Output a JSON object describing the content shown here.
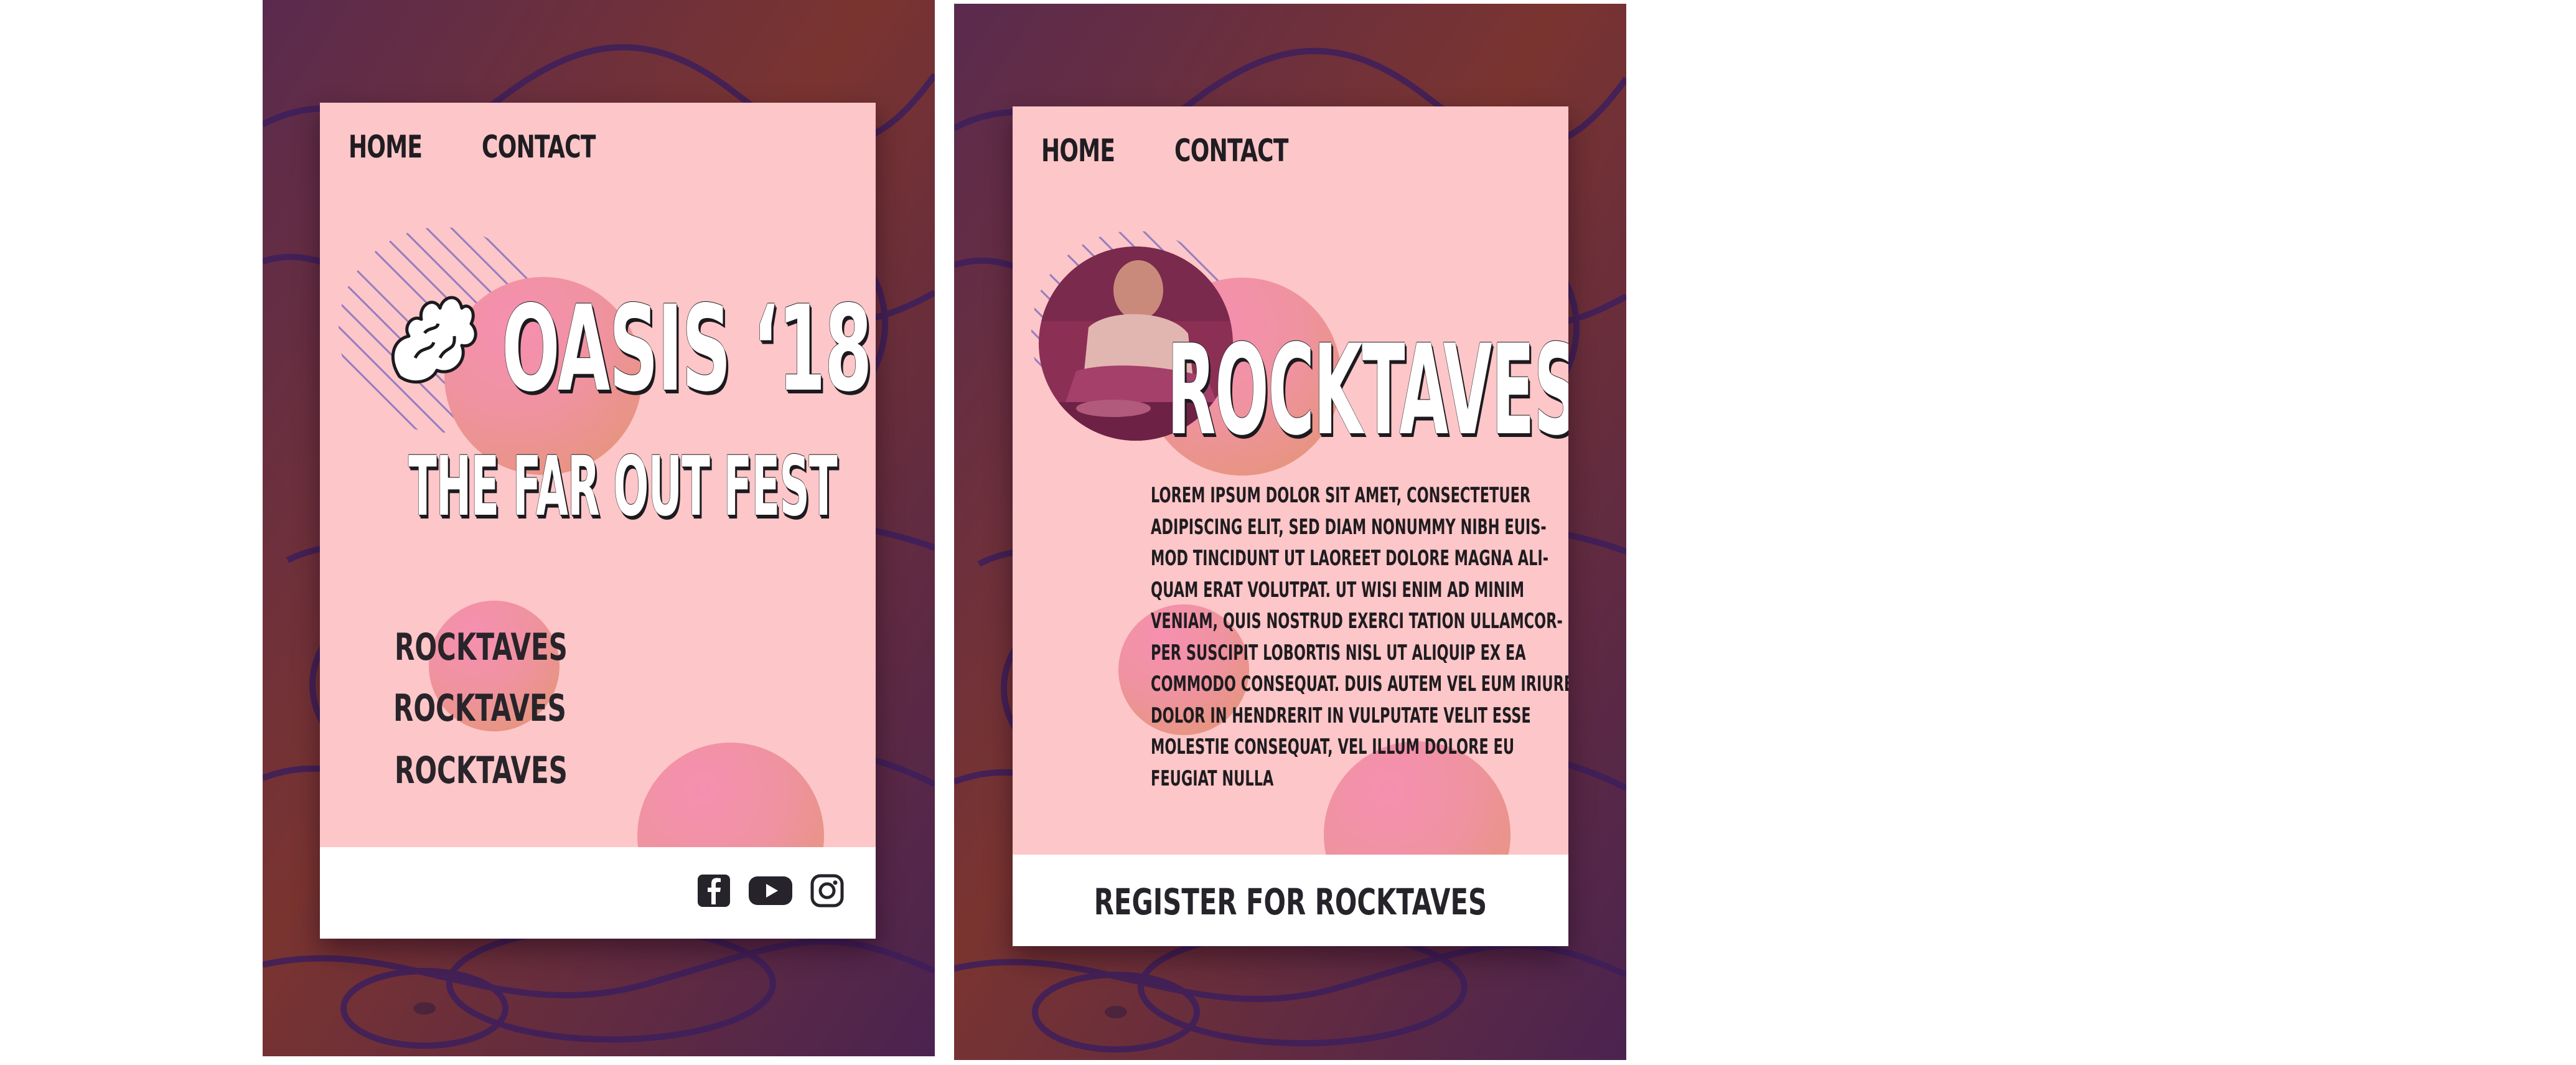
{
  "colors": {
    "card_bg": "#fdc6c8",
    "bg_dark": "#4a2355",
    "bg_orange": "#8a3a28",
    "text_dark": "#1f1d22",
    "circle_pink": "#f68fb0",
    "circle_orange": "#e39470"
  },
  "screen1": {
    "nav": {
      "home": "HOME",
      "contact": "CONTACT"
    },
    "logo_icon": "flame-hand-icon",
    "title": "OASIS ‘18",
    "subtitle": "THE FAR OUT FEST",
    "menu": [
      "ROCKTAVES",
      "ROCKTAVES",
      "ROCKTAVES"
    ],
    "social": [
      "facebook-icon",
      "youtube-icon",
      "instagram-icon"
    ]
  },
  "screen2": {
    "nav": {
      "home": "HOME",
      "contact": "CONTACT"
    },
    "title": "ROCKTAVES",
    "body": "LOREM IPSUM DOLOR SIT AMET, CONSECTETUER ADIPISCING ELIT, SED DIAM NONUMMY NIBH EUIS-MOD TINCIDUNT UT LAOREET DOLORE MAGNA ALI-QUAM ERAT VOLUTPAT. UT WISI ENIM AD MINIM VENIAM, QUIS NOSTRUD EXERCI TATION ULLAMCOR-PER SUSCIPIT LOBORTIS NISL UT ALIQUIP EX EA COMMODO CONSEQUAT. DUIS AUTEM VEL EUM IRIURE DOLOR IN HENDRERIT IN VULPUTATE VELIT ESSE MOLESTIE CONSEQUAT, VEL ILLUM DOLORE EU FEUGIAT NULLA",
    "register": "REGISTER FOR ROCKTAVES"
  }
}
